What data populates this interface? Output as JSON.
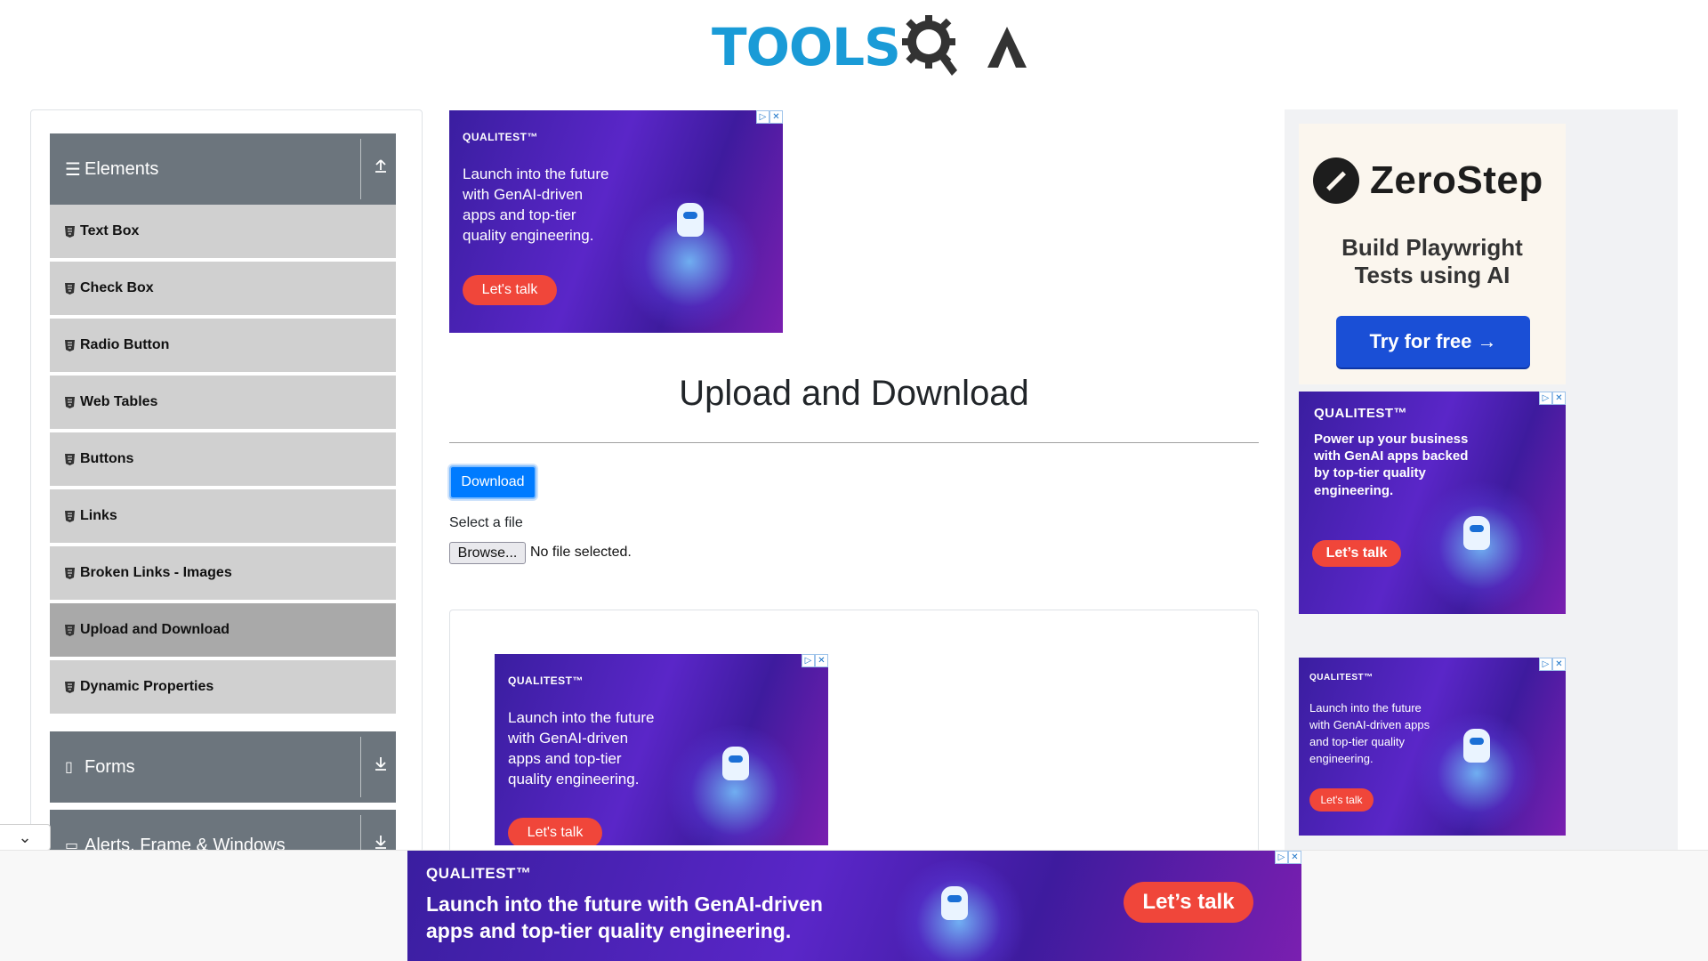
{
  "header": {
    "logo_text_tools": "TOOLS",
    "logo_text_qa": "QA"
  },
  "sidebar": {
    "groups": [
      {
        "label": "Elements",
        "expanded": true,
        "items": [
          {
            "label": "Text Box",
            "active": false
          },
          {
            "label": "Check Box",
            "active": false
          },
          {
            "label": "Radio Button",
            "active": false
          },
          {
            "label": "Web Tables",
            "active": false
          },
          {
            "label": "Buttons",
            "active": false
          },
          {
            "label": "Links",
            "active": false
          },
          {
            "label": "Broken Links - Images",
            "active": false
          },
          {
            "label": "Upload and Download",
            "active": true
          },
          {
            "label": "Dynamic Properties",
            "active": false
          }
        ]
      },
      {
        "label": "Forms",
        "expanded": false
      },
      {
        "label": "Alerts, Frame & Windows",
        "expanded": false
      }
    ]
  },
  "main": {
    "title": "Upload and Download",
    "download_label": "Download",
    "select_file_label": "Select a file",
    "browse_label": "Browse...",
    "no_file_text": "No file selected."
  },
  "ads": {
    "qualitest_brand": "QUALITEST™",
    "top": {
      "copy": "Launch into the future with GenAI-driven apps and top-tier quality engineering.",
      "cta": "Let's talk"
    },
    "mid": {
      "copy": "Launch into the future with GenAI-driven apps and top-tier quality engineering.",
      "cta": "Let's talk"
    },
    "right1": {
      "copy": "Power up your business with GenAI apps backed by top-tier quality engineering.",
      "cta": "Let’s talk"
    },
    "right2": {
      "copy": "Launch into the future with GenAI-driven apps and top-tier quality engineering.",
      "cta": "Let's talk"
    },
    "bottom": {
      "copy_line1": "Launch into the future with GenAI-driven",
      "copy_line2": "apps and top-tier quality engineering.",
      "cta": "Let’s talk"
    },
    "zerostep": {
      "brand": "ZeroStep",
      "headline_line1": "Build Playwright",
      "headline_line2": "Tests using AI",
      "cta": "Try for free →"
    },
    "badge_info": "▷",
    "badge_close": "✕"
  },
  "icons": {
    "menu": "hamburger-icon",
    "collapse": "chevron-down-icon",
    "expand_up": "upload-arrow-icon",
    "expand_down": "download-arrow-icon"
  },
  "colors": {
    "group_header": "#6c757d",
    "menu_item": "#d0d0d0",
    "menu_item_active": "#a9a9a9",
    "primary_button": "#007bff",
    "logo_blue": "#1a9bd7"
  }
}
